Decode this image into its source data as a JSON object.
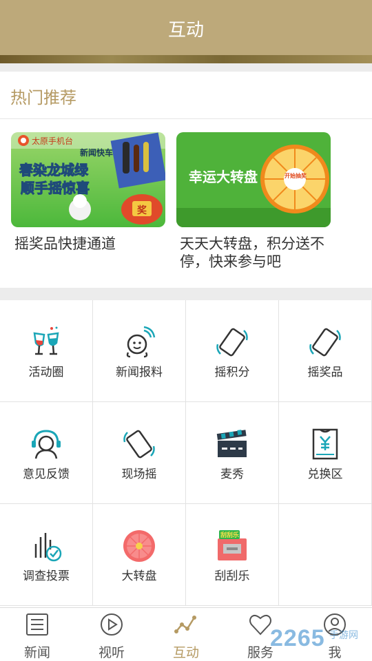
{
  "header": {
    "title": "互动"
  },
  "hot": {
    "title": "热门推荐",
    "cards": [
      {
        "caption": "摇奖品快捷通道",
        "banner_brand": "太原手机台",
        "banner_tag": "新闻快车",
        "banner_line1": "春染龙城绿",
        "banner_line2": "顺手摇惊喜",
        "banner_prize": "奖"
      },
      {
        "caption": "天天大转盘，积分送不停，快来参与吧",
        "banner_text": "幸运大转盘",
        "banner_button": "开始抽奖"
      }
    ]
  },
  "grid": {
    "items": [
      {
        "label": "活动圈",
        "icon": "wine-glasses-icon"
      },
      {
        "label": "新闻报料",
        "icon": "person-signal-icon"
      },
      {
        "label": "摇积分",
        "icon": "shake-phone-icon"
      },
      {
        "label": "摇奖品",
        "icon": "shake-phone-icon"
      },
      {
        "label": "意见反馈",
        "icon": "headset-person-icon"
      },
      {
        "label": "现场摇",
        "icon": "shake-phone-icon"
      },
      {
        "label": "麦秀",
        "icon": "clapperboard-icon"
      },
      {
        "label": "兑换区",
        "icon": "ticket-yuan-icon"
      },
      {
        "label": "调查投票",
        "icon": "vote-check-icon"
      },
      {
        "label": "大转盘",
        "icon": "wheel-icon"
      },
      {
        "label": "刮刮乐",
        "icon": "scratch-card-icon",
        "badge": "刮刮乐"
      }
    ]
  },
  "tabs": [
    {
      "label": "新闻",
      "icon": "news-icon",
      "active": false
    },
    {
      "label": "视听",
      "icon": "play-icon",
      "active": false
    },
    {
      "label": "互动",
      "icon": "interaction-icon",
      "active": true
    },
    {
      "label": "服务",
      "icon": "heart-icon",
      "active": false
    },
    {
      "label": "我",
      "icon": "user-icon",
      "active": false
    }
  ],
  "watermark": {
    "text": "2265",
    "sub": "手游网"
  },
  "colors": {
    "accent": "#b59a63",
    "header": "#bda97a",
    "icon_teal": "#1aa6b7",
    "icon_dark": "#333333"
  }
}
